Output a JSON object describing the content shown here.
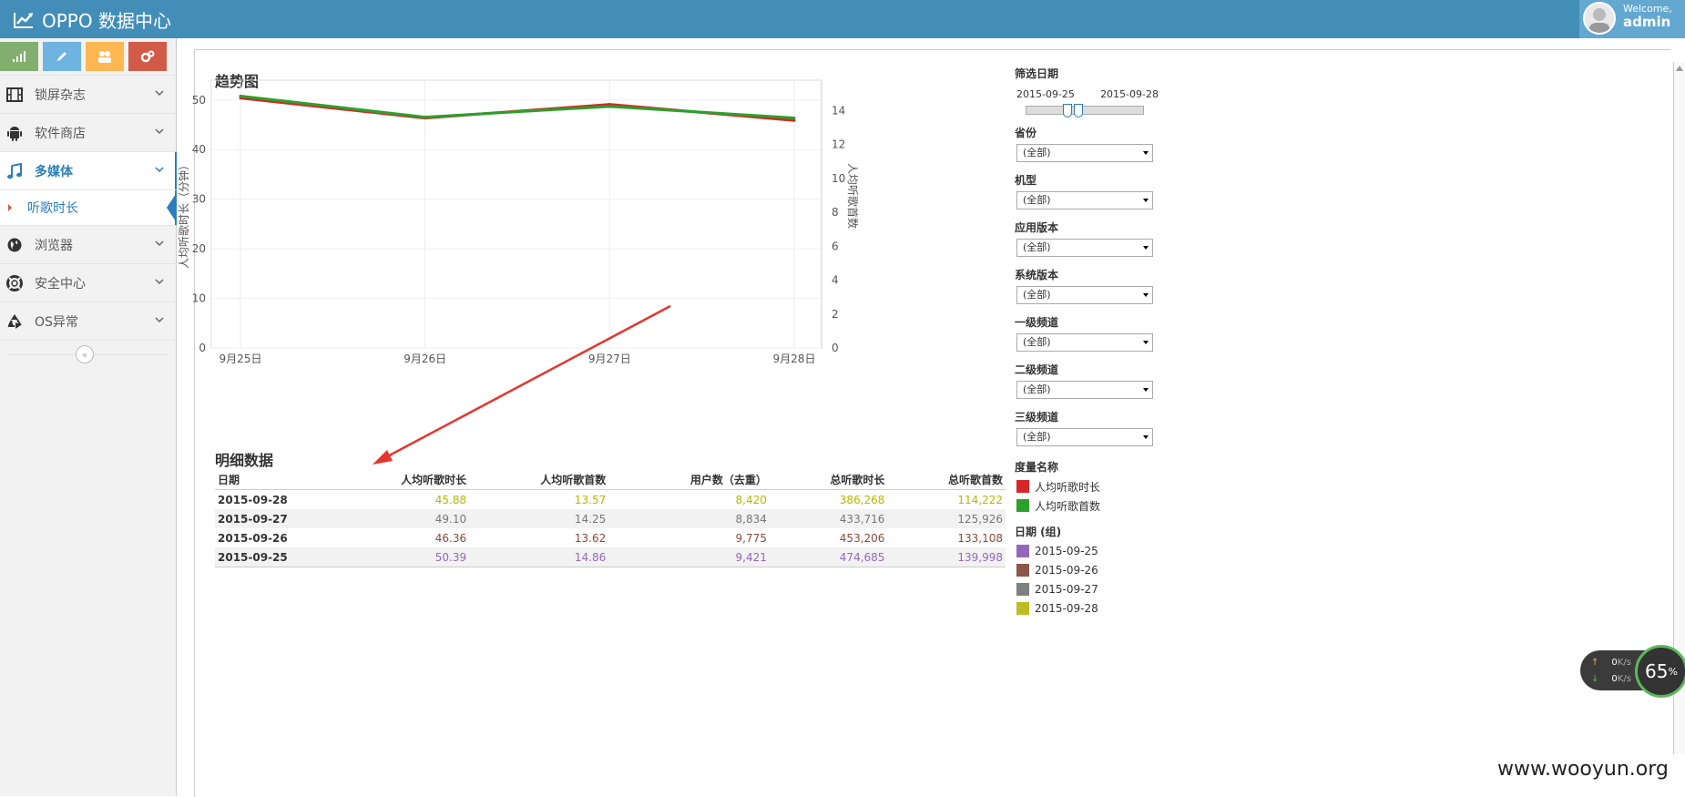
{
  "header": {
    "brand": "OPPO 数据中心",
    "welcome": "Welcome,",
    "user": "admin"
  },
  "sidebar": {
    "items": [
      {
        "label": "锁屏杂志",
        "icon": "film-icon"
      },
      {
        "label": "软件商店",
        "icon": "android-icon"
      },
      {
        "label": "多媒体",
        "icon": "music-icon",
        "active": true
      },
      {
        "label": "浏览器",
        "icon": "globe-icon"
      },
      {
        "label": "安全中心",
        "icon": "lifebuoy-icon"
      },
      {
        "label": "OS异常",
        "icon": "recycle-icon"
      }
    ],
    "sub_item": "听歌时长"
  },
  "trend": {
    "title": "趋势图"
  },
  "chart_data": {
    "type": "line",
    "categories": [
      "9月25日",
      "9月26日",
      "9月27日",
      "9月28日"
    ],
    "series": [
      {
        "name": "人均听歌时长",
        "values": [
          50.39,
          46.36,
          49.1,
          45.88
        ],
        "color": "#d62728",
        "axis": "left"
      },
      {
        "name": "人均听歌首数",
        "values": [
          14.86,
          13.62,
          14.25,
          13.57
        ],
        "color": "#2ca02c",
        "axis": "right"
      }
    ],
    "ylabel": "人均听歌时长（分钟）",
    "y2label": "人均听歌首数",
    "ylim": [
      0,
      54
    ],
    "y2lim": [
      0,
      15.8
    ],
    "yticks": [
      0,
      10,
      20,
      30,
      40,
      50
    ],
    "y2ticks": [
      0,
      2,
      4,
      6,
      8,
      10,
      12,
      14
    ],
    "grid": true
  },
  "detail": {
    "title": "明细数据",
    "columns": [
      "日期",
      "人均听歌时长",
      "人均听歌首数",
      "用户数（去重）",
      "总听歌时长",
      "总听歌首数"
    ],
    "rows": [
      {
        "date": "2015-09-28",
        "values": [
          "45.88",
          "13.57",
          "8,420",
          "386,268",
          "114,222"
        ],
        "color": "#b5b800"
      },
      {
        "date": "2015-09-27",
        "values": [
          "49.10",
          "14.25",
          "8,834",
          "433,716",
          "125,926"
        ],
        "color": "#777777"
      },
      {
        "date": "2015-09-26",
        "values": [
          "46.36",
          "13.62",
          "9,775",
          "453,206",
          "133,108"
        ],
        "color": "#8c4b3c"
      },
      {
        "date": "2015-09-25",
        "values": [
          "50.39",
          "14.86",
          "9,421",
          "474,685",
          "139,998"
        ],
        "color": "#9467bd"
      }
    ]
  },
  "filters": {
    "date_label": "筛选日期",
    "date_from": "2015-09-25",
    "date_to": "2015-09-28",
    "selects": [
      {
        "label": "省份",
        "value": "(全部)"
      },
      {
        "label": "机型",
        "value": "(全部)"
      },
      {
        "label": "应用版本",
        "value": "(全部)"
      },
      {
        "label": "系统版本",
        "value": "(全部)"
      },
      {
        "label": "一级频道",
        "value": "(全部)"
      },
      {
        "label": "二级频道",
        "value": "(全部)"
      },
      {
        "label": "三级频道",
        "value": "(全部)"
      }
    ],
    "measure_label": "度量名称",
    "measures": [
      {
        "label": "人均听歌时长",
        "color": "#d62728"
      },
      {
        "label": "人均听歌首数",
        "color": "#2ca02c"
      }
    ],
    "dategroup_label": "日期 (组)",
    "dates": [
      {
        "label": "2015-09-25",
        "color": "#9467bd"
      },
      {
        "label": "2015-09-26",
        "color": "#8c564b"
      },
      {
        "label": "2015-09-27",
        "color": "#7f7f7f"
      },
      {
        "label": "2015-09-28",
        "color": "#bcbd22"
      }
    ]
  },
  "netwidget": {
    "up": "0",
    "down": "0",
    "unit": "K/s",
    "percent": "65",
    "percent_sign": "%"
  },
  "watermark": "www.wooyun.org"
}
